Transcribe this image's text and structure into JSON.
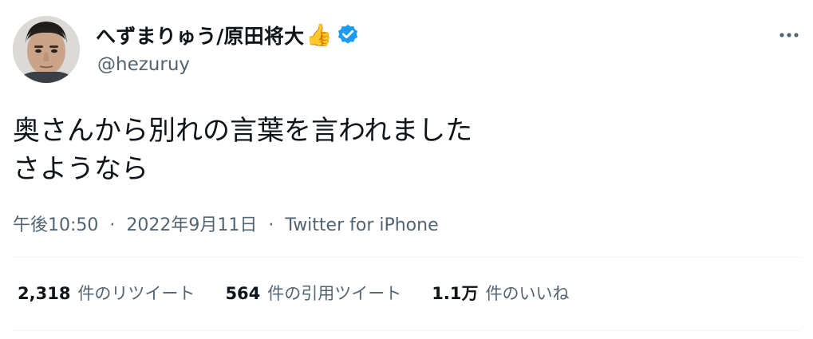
{
  "user": {
    "display_name": "へずまりゅう/原田将大",
    "emoji": "👍",
    "handle": "@hezuruy",
    "verified_icon": "verified-badge-icon",
    "verified_color": "#1d9bf0"
  },
  "tweet": {
    "line1": "奥さんから別れの言葉を言われました",
    "line2": "さようなら",
    "time": "午後10:50",
    "date": "2022年9月11日",
    "separator": "·",
    "source": "Twitter for iPhone"
  },
  "stats": {
    "retweets_value": "2,318",
    "retweets_label": "件のリツイート",
    "quotes_value": "564",
    "quotes_label": "件の引用ツイート",
    "likes_value": "1.1万",
    "likes_label": "件のいいね"
  },
  "icons": {
    "more": "more-dots-icon"
  }
}
